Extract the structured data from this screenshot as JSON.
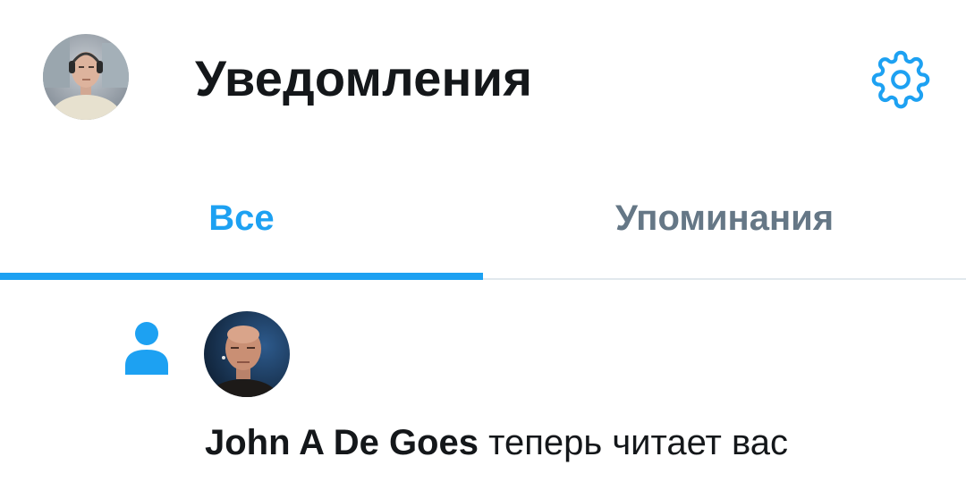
{
  "header": {
    "title": "Уведомления",
    "avatar_icon": "user-avatar",
    "settings_icon": "gear-icon"
  },
  "tabs": [
    {
      "label": "Все",
      "active": true
    },
    {
      "label": "Упоминания",
      "active": false
    }
  ],
  "notification": {
    "type_icon": "person-icon",
    "user_name": "John A De Goes",
    "action_text": "теперь читает вас"
  },
  "colors": {
    "accent": "#1da1f2",
    "text_primary": "#14171a",
    "text_secondary": "#657786",
    "divider": "#e1e8ed"
  }
}
